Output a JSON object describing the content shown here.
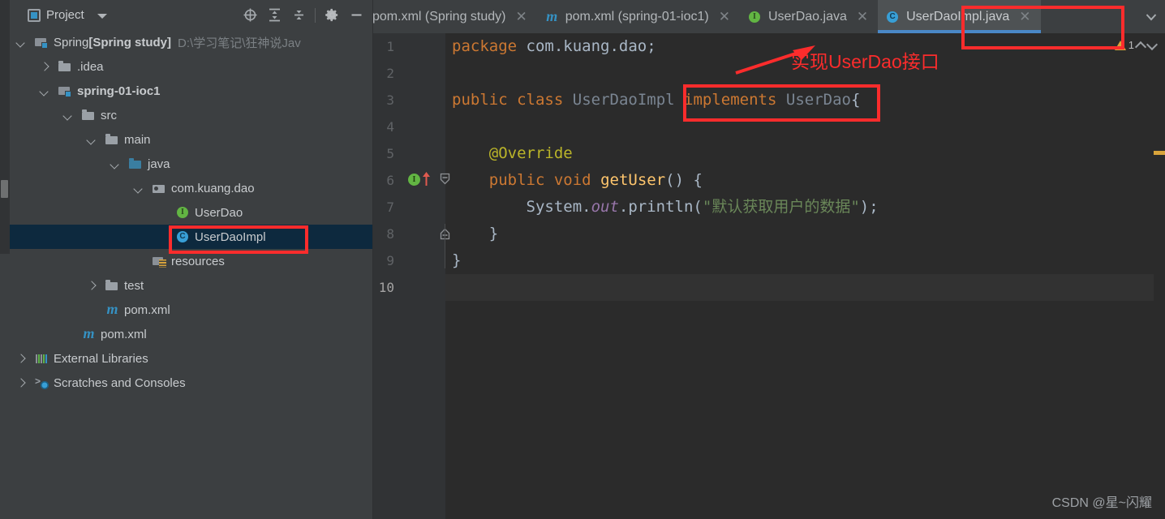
{
  "panel": {
    "title": "Project",
    "icons": {
      "project": "project-window-icon",
      "caret": "chevron-down-icon",
      "locate": "scroll-from-source-icon",
      "expand": "expand-all-icon",
      "collapse": "collapse-all-icon",
      "settings": "gear-icon",
      "hide": "minimize-icon"
    }
  },
  "tree": [
    {
      "label": "Spring",
      "bold_label": "[Spring study]",
      "path": "D:\\学习笔记\\狂神说Jav",
      "icon": "module-folder-icon",
      "arrow": "down",
      "indent": 0,
      "selected": false
    },
    {
      "label": ".idea",
      "icon": "folder-icon",
      "arrow": "right",
      "indent": 1,
      "selected": false
    },
    {
      "label": "spring-01-ioc1",
      "bold": true,
      "icon": "module-folder-icon",
      "arrow": "down",
      "indent": 1,
      "selected": false
    },
    {
      "label": "src",
      "icon": "folder-icon",
      "arrow": "down",
      "indent": 2,
      "selected": false
    },
    {
      "label": "main",
      "icon": "folder-icon",
      "arrow": "down",
      "indent": 3,
      "selected": false
    },
    {
      "label": "java",
      "icon": "source-folder-icon",
      "arrow": "down",
      "indent": 4,
      "selected": false
    },
    {
      "label": "com.kuang.dao",
      "icon": "package-icon",
      "arrow": "down",
      "indent": 5,
      "selected": false
    },
    {
      "label": "UserDao",
      "icon": "interface-icon",
      "arrow": "none",
      "indent": 6,
      "selected": false
    },
    {
      "label": "UserDaoImpl",
      "icon": "class-icon",
      "arrow": "none",
      "indent": 6,
      "selected": true
    },
    {
      "label": "resources",
      "icon": "resources-folder-icon",
      "arrow": "none",
      "indent": 5,
      "selected": false
    },
    {
      "label": "test",
      "icon": "folder-icon",
      "arrow": "right",
      "indent": 3,
      "selected": false
    },
    {
      "label": "pom.xml",
      "icon": "maven-icon",
      "arrow": "none",
      "indent": 3,
      "selected": false
    },
    {
      "label": "pom.xml",
      "icon": "maven-icon",
      "arrow": "none",
      "indent": 2,
      "selected": false
    },
    {
      "label": "External Libraries",
      "icon": "external-libraries-icon",
      "arrow": "right",
      "indent": 0,
      "selected": false
    },
    {
      "label": "Scratches and Consoles",
      "icon": "scratches-icon",
      "arrow": "right",
      "indent": 0,
      "selected": false
    }
  ],
  "tabs": [
    {
      "label": "pom.xml (Spring study)",
      "icon": "maven-icon",
      "active": false,
      "clipped_left": true
    },
    {
      "label": "pom.xml (spring-01-ioc1)",
      "icon": "maven-icon",
      "active": false
    },
    {
      "label": "UserDao.java",
      "icon": "interface-icon",
      "active": false
    },
    {
      "label": "UserDaoImpl.java",
      "icon": "class-icon",
      "active": true
    }
  ],
  "tab_overflow_icon": "chevron-down-icon",
  "editor": {
    "lines": [
      {
        "n": "1",
        "current": false
      },
      {
        "n": "2",
        "current": false
      },
      {
        "n": "3",
        "current": false
      },
      {
        "n": "4",
        "current": false
      },
      {
        "n": "5",
        "current": false
      },
      {
        "n": "6",
        "current": false,
        "gutter_icon": "implementing-method-icon"
      },
      {
        "n": "7",
        "current": false
      },
      {
        "n": "8",
        "current": false
      },
      {
        "n": "9",
        "current": false
      },
      {
        "n": "10",
        "current": true
      }
    ],
    "code": {
      "l1_kw": "package",
      "l1_pkg": " com.kuang.dao;",
      "l3_kw1": "public",
      "l3_kw2": "class",
      "l3_name": "UserDaoImpl",
      "l3_kw3": "implements",
      "l3_iface": "UserDao",
      "l3_brace": "{",
      "l5_annotation": "@Override",
      "l6_kw1": "public",
      "l6_kw2": "void",
      "l6_fn": "getUser",
      "l6_tail": "() {",
      "l7_sys": "System.",
      "l7_out": "out",
      "l7_println": ".println(",
      "l7_string": "\"默认获取用户的数据\"",
      "l7_tail": ");",
      "l8_brace": "}",
      "l9_brace": "}"
    }
  },
  "inspection": {
    "warning_count": "1",
    "warning_icon": "warning-triangle-icon",
    "prev_icon": "chevron-up-icon",
    "next_icon": "chevron-down-icon"
  },
  "annotations": {
    "callout_text": "实现UserDao接口",
    "arrow_icon": "red-arrow-icon",
    "color": "#fb2c2c"
  },
  "watermark": "CSDN @星~闪耀"
}
